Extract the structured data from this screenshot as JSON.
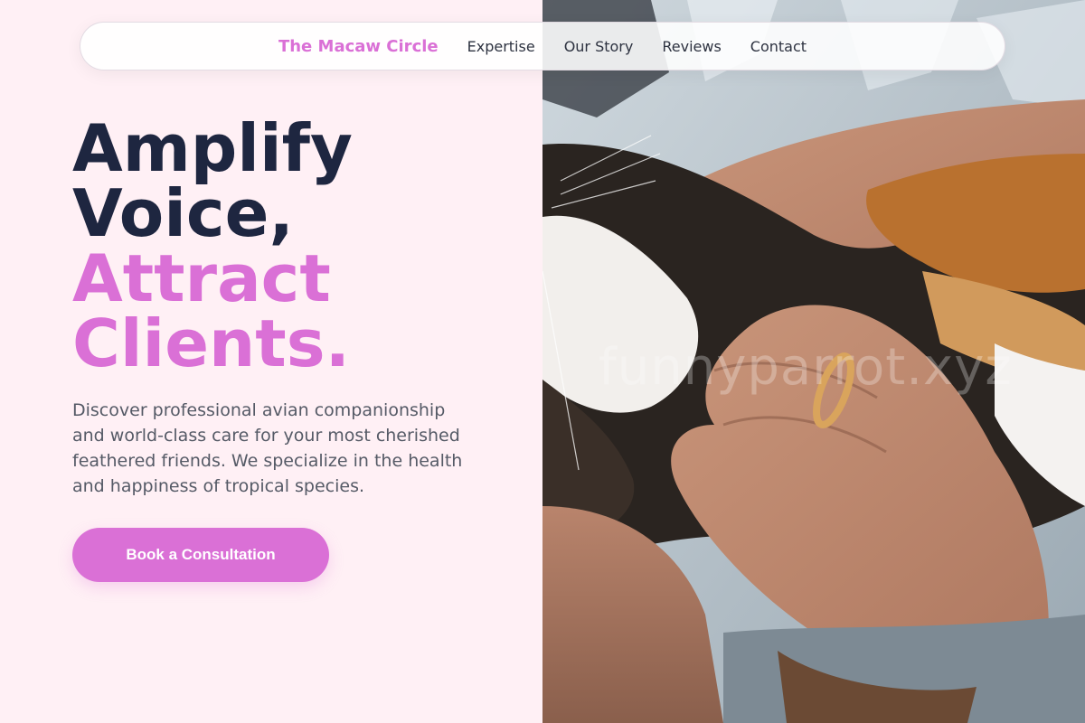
{
  "nav": {
    "brand": "The Macaw Circle",
    "links": [
      "Expertise",
      "Our Story",
      "Reviews",
      "Contact"
    ]
  },
  "hero": {
    "headline_lines": [
      "Amplify",
      "Voice,",
      "Attract",
      "Clients."
    ],
    "description": "Discover professional avian companionship and world-class care for your most cherished feathered friends. We specialize in the health and happiness of tropical species.",
    "cta_label": "Book a Consultation"
  },
  "photo": {
    "watermark": "funnyparrot.xyz"
  },
  "colors": {
    "accent": "#da70d6",
    "heading": "#1e2640",
    "background": "#fff0f5"
  }
}
